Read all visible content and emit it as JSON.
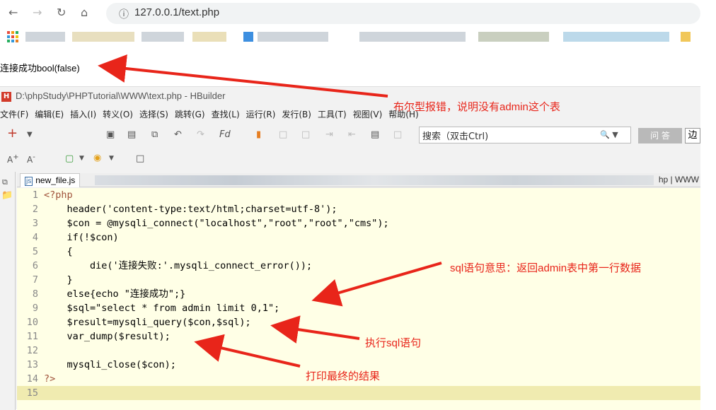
{
  "browser": {
    "address": "127.0.0.1/text.php",
    "page_output": "连接成功bool(false)"
  },
  "hbuilder": {
    "title": "D:\\phpStudy\\PHPTutorial\\WWW\\text.php  -  HBuilder",
    "menu": [
      "文件(F)",
      "编辑(E)",
      "插入(I)",
      "转义(O)",
      "选择(S)",
      "跳转(G)",
      "查找(L)",
      "运行(R)",
      "发行(B)",
      "工具(T)",
      "视图(V)",
      "帮助(H)"
    ],
    "search_placeholder": "搜索（双击Ctrl)",
    "ask_label": "问 答",
    "edge_label": "边",
    "tab_label": "new_file.js",
    "tab_right": "hp | WWW"
  },
  "code_lines": [
    {
      "n": "1",
      "text": "<?php"
    },
    {
      "n": "2",
      "text": "    header('content-type:text/html;charset=utf-8');"
    },
    {
      "n": "3",
      "text": "    $con = @mysqli_connect(\"localhost\",\"root\",\"root\",\"cms\");"
    },
    {
      "n": "4",
      "text": "    if(!$con)"
    },
    {
      "n": "5",
      "text": "    {"
    },
    {
      "n": "6",
      "text": "        die('连接失败:'.mysqli_connect_error());"
    },
    {
      "n": "7",
      "text": "    }"
    },
    {
      "n": "8",
      "text": "    else{echo \"连接成功\";}"
    },
    {
      "n": "9",
      "text": "    $sql=\"select * from admin limit 0,1\";"
    },
    {
      "n": "10",
      "text": "    $result=mysqli_query($con,$sql);"
    },
    {
      "n": "11",
      "text": "    var_dump($result);"
    },
    {
      "n": "12",
      "text": ""
    },
    {
      "n": "13",
      "text": "    mysqli_close($con);"
    },
    {
      "n": "14",
      "text": "?>"
    },
    {
      "n": "15",
      "text": ""
    }
  ],
  "annotations": {
    "bool_error": "布尔型报错，说明没有admin这个表",
    "sql_meaning": "sql语句意思：返回admin表中第一行数据",
    "exec_sql": "执行sql语句",
    "print_result": "打印最终的结果"
  },
  "colors": {
    "annotation": "#e8251a",
    "editor_bg": "#ffffe6"
  }
}
